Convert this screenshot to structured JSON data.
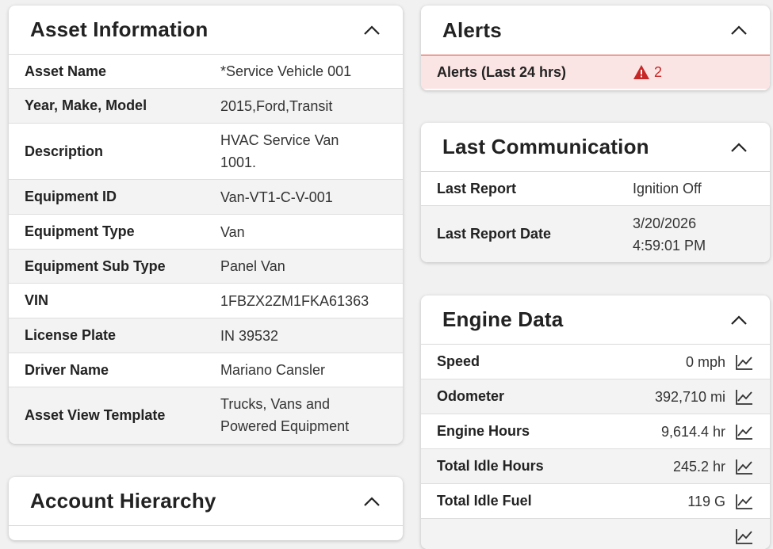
{
  "asset": {
    "title": "Asset Information",
    "rows": [
      {
        "label": "Asset Name",
        "value": "*Service Vehicle 001"
      },
      {
        "label": "Year, Make, Model",
        "value": "2015,Ford,Transit"
      },
      {
        "label": "Description",
        "value": "HVAC Service Van 1001."
      },
      {
        "label": "Equipment ID",
        "value": "Van-VT1-C-V-001"
      },
      {
        "label": "Equipment Type",
        "value": "Van"
      },
      {
        "label": "Equipment Sub Type",
        "value": "Panel Van"
      },
      {
        "label": "VIN",
        "value": "1FBZX2ZM1FKA61363"
      },
      {
        "label": "License Plate",
        "value": "IN 39532"
      },
      {
        "label": "Driver Name",
        "value": "Mariano Cansler"
      },
      {
        "label": "Asset View Template",
        "value": "Trucks, Vans and Powered Equipment"
      }
    ]
  },
  "hierarchy": {
    "title": "Account Hierarchy"
  },
  "alerts": {
    "title": "Alerts",
    "row_label": "Alerts (Last 24 hrs)",
    "count": "2"
  },
  "comm": {
    "title": "Last Communication",
    "rows": [
      {
        "label": "Last Report",
        "value": "Ignition Off"
      },
      {
        "label": "Last Report Date",
        "value": "3/20/2026 4:59:01 PM"
      }
    ]
  },
  "engine": {
    "title": "Engine Data",
    "rows": [
      {
        "label": "Speed",
        "value": "0 mph"
      },
      {
        "label": "Odometer",
        "value": "392,710 mi"
      },
      {
        "label": "Engine Hours",
        "value": "9,614.4 hr"
      },
      {
        "label": "Total Idle Hours",
        "value": "245.2 hr"
      },
      {
        "label": "Total Idle Fuel",
        "value": "119 G"
      },
      {
        "label": "",
        "value": ""
      }
    ]
  },
  "colors": {
    "alert": "#c62828",
    "alert_bg": "#fbe5e4",
    "row_alt": "#f3f3f4"
  },
  "icons": {
    "collapse": "chevron-up-icon",
    "alert": "warning-triangle-icon",
    "trend": "trend-chart-icon"
  }
}
